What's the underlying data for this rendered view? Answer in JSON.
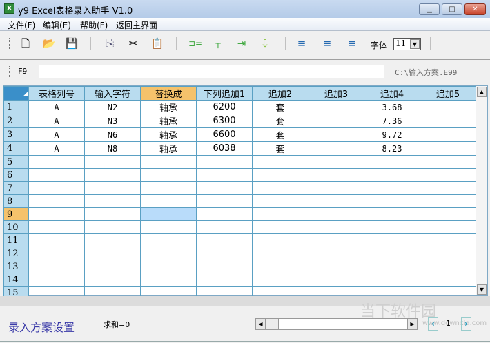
{
  "window": {
    "title": "y9 Excel表格录入助手  V1.0",
    "app_icon": "X",
    "minimize": "▁",
    "maximize": "□",
    "close": "✕"
  },
  "menu": [
    "文件(F)",
    "编辑(E)",
    "帮助(F)",
    "返回主界面"
  ],
  "toolbar": {
    "font_label": "字体",
    "font_size": "11"
  },
  "formula": {
    "cell_ref": "F9",
    "value": "",
    "path": "C:\\输入方案.E99"
  },
  "grid": {
    "headers": [
      "表格列号",
      "输入字符",
      "替换成",
      "下列追加1",
      "追加2",
      "追加3",
      "追加4",
      "追加5"
    ],
    "rows": [
      [
        "A",
        "N2",
        "轴承",
        "6200",
        "套",
        "",
        "3.68",
        ""
      ],
      [
        "A",
        "N3",
        "轴承",
        "6300",
        "套",
        "",
        "7.36",
        ""
      ],
      [
        "A",
        "N6",
        "轴承",
        "6600",
        "套",
        "",
        "9.72",
        ""
      ],
      [
        "A",
        "N8",
        "轴承",
        "6038",
        "套",
        "",
        "8.23",
        ""
      ],
      [
        "",
        "",
        "",
        "",
        "",
        "",
        "",
        ""
      ],
      [
        "",
        "",
        "",
        "",
        "",
        "",
        "",
        ""
      ],
      [
        "",
        "",
        "",
        "",
        "",
        "",
        "",
        ""
      ],
      [
        "",
        "",
        "",
        "",
        "",
        "",
        "",
        ""
      ],
      [
        "",
        "",
        "",
        "",
        "",
        "",
        "",
        ""
      ],
      [
        "",
        "",
        "",
        "",
        "",
        "",
        "",
        ""
      ],
      [
        "",
        "",
        "",
        "",
        "",
        "",
        "",
        ""
      ],
      [
        "",
        "",
        "",
        "",
        "",
        "",
        "",
        ""
      ],
      [
        "",
        "",
        "",
        "",
        "",
        "",
        "",
        ""
      ],
      [
        "",
        "",
        "",
        "",
        "",
        "",
        "",
        ""
      ],
      [
        "",
        "",
        "",
        "",
        "",
        "",
        "",
        ""
      ]
    ],
    "row_numbers": [
      "1",
      "2",
      "3",
      "4",
      "5",
      "6",
      "7",
      "8",
      "9",
      "10",
      "11",
      "12",
      "13",
      "14",
      "15"
    ],
    "selected_row": 9,
    "selected_column": 3
  },
  "status": {
    "settings_link": "录入方案设置",
    "sum": "求和=0",
    "page": "1",
    "watermark": "当下软件园",
    "watermark_url": "www.downxia.com"
  }
}
